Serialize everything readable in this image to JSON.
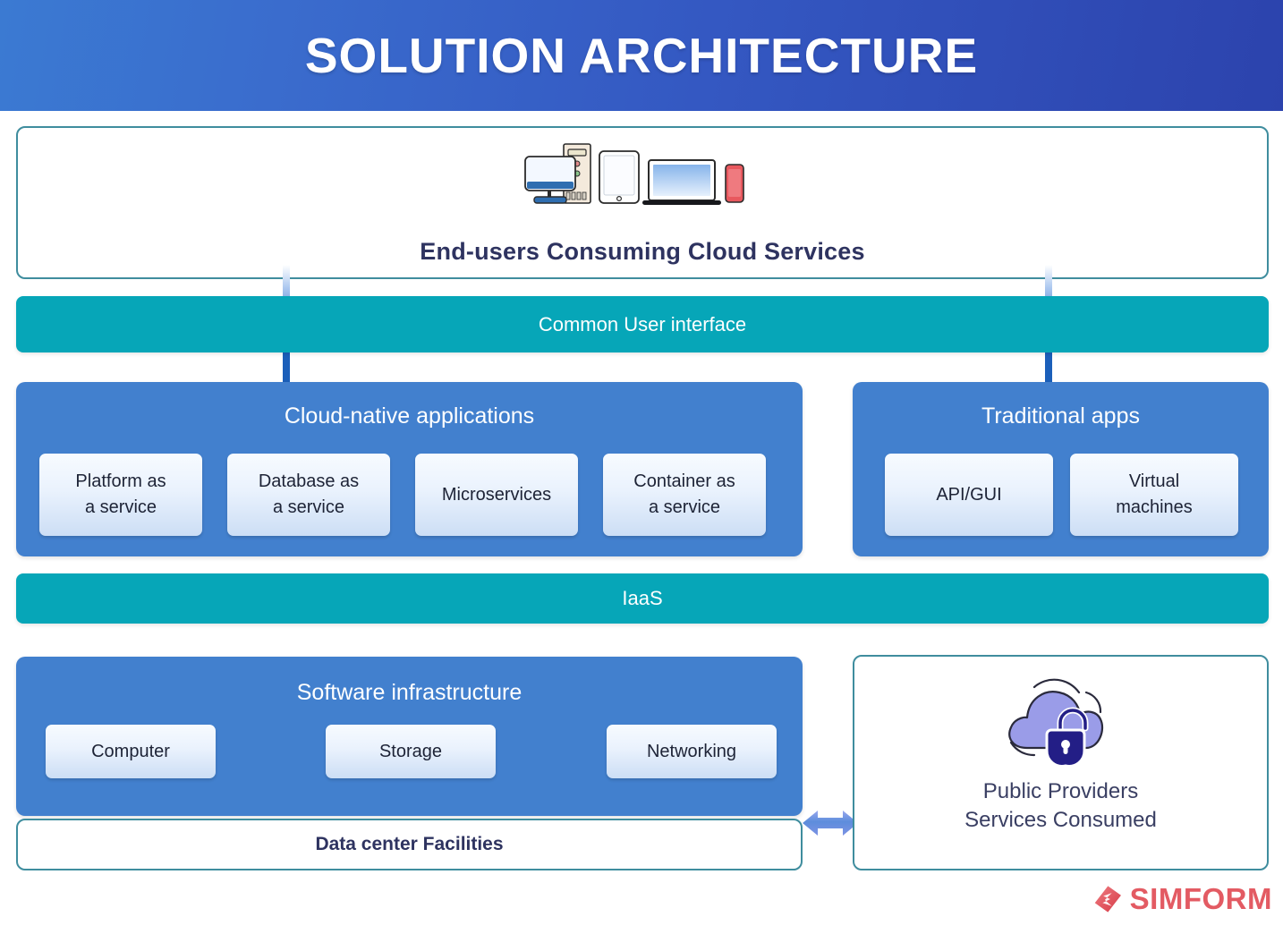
{
  "header": {
    "title": "SOLUTION ARCHITECTURE"
  },
  "endusers": {
    "caption": "End-users Consuming Cloud Services",
    "devices": [
      "desktop-computer-icon",
      "tablet-icon",
      "laptop-icon",
      "smartphone-icon"
    ]
  },
  "common_ui": {
    "label": "Common User interface"
  },
  "cloud_native": {
    "title": "Cloud-native applications",
    "cards": [
      {
        "label": "Platform as\na service",
        "line1": "Platform as",
        "line2": "a service"
      },
      {
        "label": "Database as\na service",
        "line1": "Database as",
        "line2": "a service"
      },
      {
        "label": "Microservices",
        "line1": "Microservices",
        "line2": ""
      },
      {
        "label": "Container as\na service",
        "line1": "Container as",
        "line2": "a service"
      }
    ]
  },
  "traditional": {
    "title": "Traditional apps",
    "cards": [
      {
        "label": "API/GUI",
        "line1": "API/GUI",
        "line2": ""
      },
      {
        "label": "Virtual\nmachines",
        "line1": "Virtual",
        "line2": "machines"
      }
    ]
  },
  "iaas": {
    "label": "IaaS"
  },
  "software_infra": {
    "title": "Software infrastructure",
    "cards": [
      {
        "label": "Computer"
      },
      {
        "label": "Storage"
      },
      {
        "label": "Networking"
      }
    ]
  },
  "datacenter": {
    "label": "Data center Facilities"
  },
  "public_providers": {
    "icon": "cloud-lock-icon",
    "line1": "Public Providers",
    "line2": "Services Consumed"
  },
  "brand": {
    "name": "SIMFORM",
    "mark": "simform-diamond-icon"
  },
  "connectors": {
    "left_arrow": "down-arrow-to-cloud-native",
    "right_arrow": "down-arrow-to-traditional-apps",
    "infra_link": "bidirectional-arrow-infra-to-public-providers"
  },
  "colors": {
    "header_gradient_start": "#3b7ad2",
    "header_gradient_end": "#2c43ad",
    "teal": "#06a6b8",
    "panel_blue": "#4280ce",
    "navy_text": "#2e3360",
    "box_border": "#3f8d9e",
    "brand_red": "#e35b63",
    "cloud_purple": "#9a9ce8",
    "lock_navy": "#231e86"
  }
}
